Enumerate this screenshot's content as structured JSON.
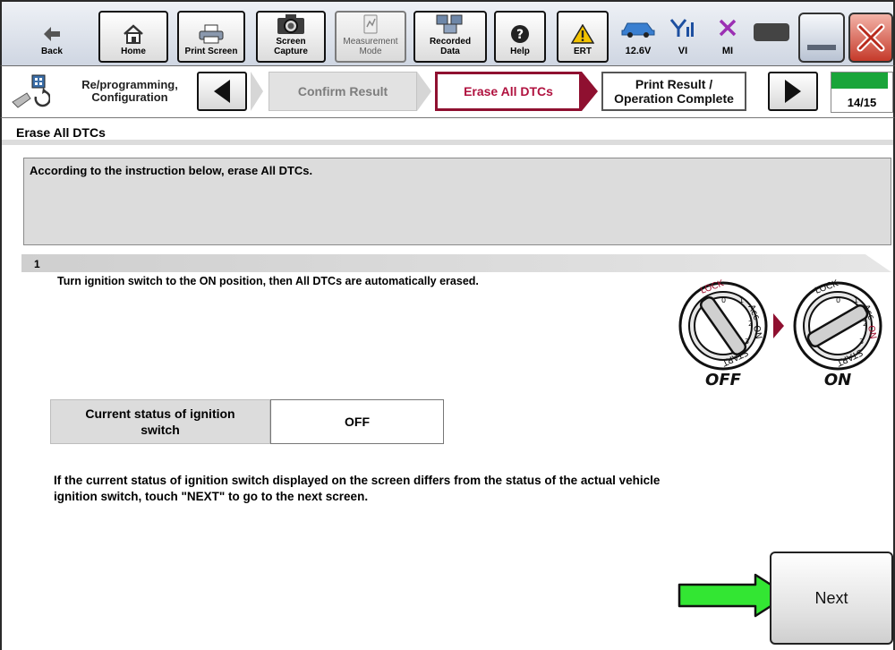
{
  "toolbar": {
    "back": {
      "label": "Back",
      "icon": "back-arrow-icon"
    },
    "home": {
      "label": "Home",
      "icon": "home-icon"
    },
    "print_screen": {
      "label": "Print Screen",
      "icon": "printer-icon"
    },
    "screen_capture": {
      "label": "Screen\nCapture",
      "icon": "camera-icon"
    },
    "measurement_mode": {
      "label": "Measurement\nMode",
      "icon": "measurement-icon"
    },
    "recorded_data": {
      "label": "Recorded\nData",
      "icon": "recorded-data-icon"
    },
    "help": {
      "label": "Help",
      "icon": "help-icon"
    },
    "ert": {
      "label": "ERT",
      "icon": "warning-icon"
    },
    "battery": {
      "label": "12.6V",
      "icon": "car-icon"
    },
    "vi": {
      "label": "VI",
      "icon": "signal-icon"
    },
    "mi": {
      "label": "MI",
      "icon": "cross-icon"
    }
  },
  "nav": {
    "section_label": "Re/programming,\nConfiguration",
    "steps": [
      {
        "label": "Confirm Result",
        "state": "done"
      },
      {
        "label": "Erase All DTCs",
        "state": "current"
      },
      {
        "label": "Print Result /\nOperation Complete",
        "state": "next"
      }
    ],
    "progress_text": "14/15",
    "progress_fraction": 0.93,
    "colors": {
      "current_step": "#b0123f",
      "progress": "#1aa53a"
    }
  },
  "page": {
    "title": "Erase All DTCs",
    "instruction": "According to the instruction below, erase All DTCs.",
    "step_number": "1",
    "step_text": "Turn ignition switch to the ON position, then All DTCs are automatically erased.",
    "ignition": {
      "off_label": "OFF",
      "on_label": "ON",
      "dial_lock": "LOCK",
      "dial_acc": "Acc",
      "dial_on": "ON",
      "dial_start": "START",
      "dial_zero": "0",
      "dial_one": "1",
      "dial_two": "2",
      "dial_three": "3"
    },
    "status_label": "Current status of ignition switch",
    "status_value": "OFF",
    "note": "If the current status of ignition switch displayed on the screen differs from the status of the actual vehicle ignition switch, touch \"NEXT\" to go to the next screen.",
    "next_label": "Next"
  }
}
